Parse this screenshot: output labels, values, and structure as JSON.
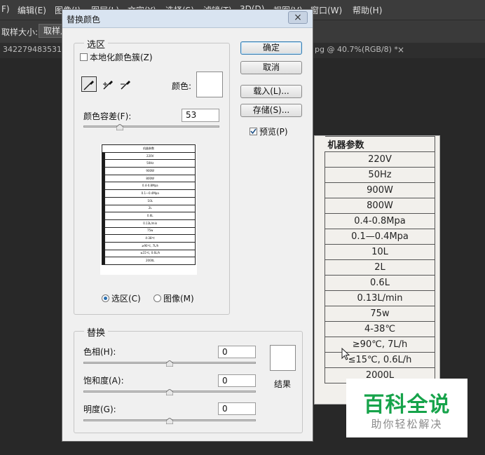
{
  "menubar": {
    "items": [
      "F)",
      "编辑(E)",
      "图像(I)",
      "图层(L)",
      "文字(Y)",
      "选择(S)",
      "滤镜(T)",
      "3D(D)",
      "视图(V)",
      "窗口(W)",
      "帮助(H)"
    ]
  },
  "options_bar": {
    "sample_size_label": "取样大小:",
    "sample_value": "取样点"
  },
  "doc_tabs": {
    "left_tab": "342279483531",
    "right_tab": "pg @ 40.7%(RGB/8) *",
    "close_glyph": "×"
  },
  "document": {
    "header": "机器参数",
    "values": [
      "220V",
      "50Hz",
      "900W",
      "800W",
      "0.4-0.8Mpa",
      "0.1—0.4Mpa",
      "10L",
      "2L",
      "0.6L",
      "0.13L/min",
      "75w",
      "4-38℃",
      "≥90℃, 7L/h",
      "≤15℃, 0.6L/h",
      "2000L"
    ]
  },
  "watermark": {
    "title": "百科全说",
    "subtitle": "助你轻松解决"
  },
  "dialog": {
    "title": "替换颜色",
    "close_glyph": "×",
    "selection": {
      "legend": "选区",
      "localized_label": "本地化颜色簇(Z)",
      "localized_checked": false,
      "color_label": "颜色:",
      "fuzziness_label": "颜色容差(F):",
      "fuzziness_value": "53",
      "fuzziness_level": 0.27,
      "radio_selection": "选区(C)",
      "radio_image": "图像(M)",
      "selected_mode": "selection",
      "swatch_color": "#ffffff"
    },
    "buttons": {
      "ok": "确定",
      "cancel": "取消",
      "load": "载入(L)...",
      "save": "存储(S)..."
    },
    "preview_label": "预览(P)",
    "preview_checked": true,
    "replacement": {
      "legend": "替换",
      "hue_label": "色相(H):",
      "hue_value": "0",
      "saturation_label": "饱和度(A):",
      "saturation_value": "0",
      "lightness_label": "明度(G):",
      "lightness_value": "0",
      "result_label": "结果",
      "result_color": "#ffffff",
      "slider_level": 0.5
    }
  }
}
